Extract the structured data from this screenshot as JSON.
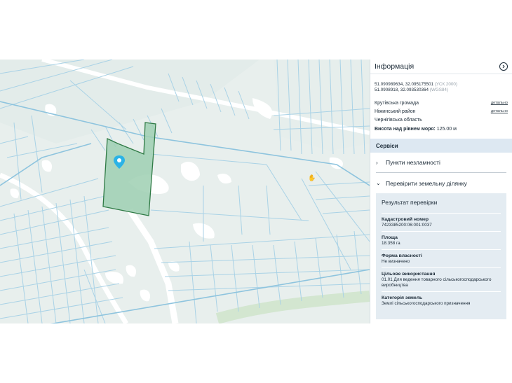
{
  "panel": {
    "title": "Інформація",
    "close_icon": "chevron-right-circle-icon",
    "coords": [
      {
        "value": "51.090989634, 32.095175501",
        "system": "(УСК 2000)"
      },
      {
        "value": "51.0908918, 32.093530364",
        "system": "(WGS84)"
      }
    ],
    "admin": [
      {
        "name": "Крутівська громада",
        "link": "детальнo"
      },
      {
        "name": "Ніжинський район",
        "link": "детальнo"
      },
      {
        "name": "Чернігівська область",
        "link": ""
      }
    ],
    "elevation_label": "Висота над рівнем моря:",
    "elevation_value": "125.00 м",
    "services_title": "Сервіси",
    "accordion": [
      {
        "label": "Пункти незламності",
        "state": "collapsed"
      },
      {
        "label": "Перевірити земельну ділянку",
        "state": "expanded"
      }
    ],
    "result": {
      "title": "Результат перевірки",
      "fields": [
        {
          "label": "Кадастровий номер",
          "value": "7423385200:06:001:0037"
        },
        {
          "label": "Площа",
          "value": "18.358 га"
        },
        {
          "label": "Форма власності",
          "value": "Не визначено"
        },
        {
          "label": "Цільове використання",
          "value": "01.01 Для ведення товарного сільськогосподарського виробництва"
        },
        {
          "label": "Категорія земель",
          "value": "Землі сільськогосподарського призначення"
        }
      ]
    }
  },
  "map": {
    "marker_icon": "map-pin-icon",
    "selected_color": "#9ecfb2",
    "line_color": "#a9d2e6",
    "background": "#e8efed"
  }
}
